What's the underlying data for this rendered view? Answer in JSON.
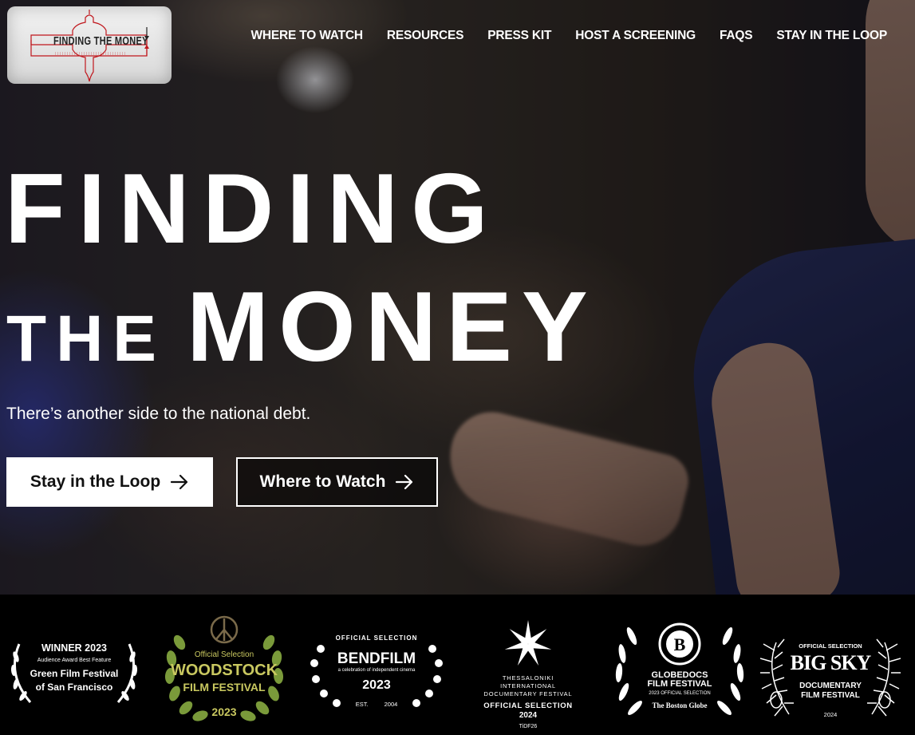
{
  "logo": {
    "text": "FINDING THE MONEY"
  },
  "nav": {
    "items": [
      {
        "label": "WHERE TO WATCH"
      },
      {
        "label": "RESOURCES"
      },
      {
        "label": "PRESS KIT"
      },
      {
        "label": "HOST A SCREENING"
      },
      {
        "label": "FAQS"
      },
      {
        "label": "STAY IN THE LOOP"
      }
    ]
  },
  "hero": {
    "title_line1": "FINDING",
    "title_the": "THE",
    "title_money": "MONEY",
    "tagline": "There’s another side to the national debt.",
    "buttons": {
      "primary": "Stay in the Loop",
      "secondary": "Where to Watch"
    }
  },
  "laurels": [
    {
      "line1": "WINNER 2023",
      "line2": "Audience Award Best Feature",
      "line3": "Green Film Festival",
      "line4": "of San Francisco"
    },
    {
      "line1": "Official Selection",
      "line2": "WOODSTOCK",
      "line3": "FILM FESTIVAL",
      "line4": "2023"
    },
    {
      "line1": "OFFICIAL SELECTION",
      "line2": "BENDFILM",
      "line3": "a celebration of independent cinema",
      "line4": "2023",
      "line5": "EST. 2004"
    },
    {
      "line1": "THESSALONIKI",
      "line2": "INTERNATIONAL",
      "line3": "DOCUMENTARY FESTIVAL",
      "line4": "OFFICIAL SELECTION",
      "line5": "2024",
      "line6": "TiDF26"
    },
    {
      "line1": "GLOBEDOCS",
      "line2": "FILM FESTIVAL",
      "line3": "2023 OFFICIAL SELECTION",
      "line4": "The Boston Globe"
    },
    {
      "line1": "OFFICIAL SELECTION",
      "line2": "BIG SKY",
      "line3": "DOCUMENTARY",
      "line4": "FILM FESTIVAL",
      "line5": "2024"
    }
  ],
  "colors": {
    "accent_red": "#c0161c",
    "woodstock_green": "#7a9a3a",
    "woodstock_text": "#c9c860"
  }
}
